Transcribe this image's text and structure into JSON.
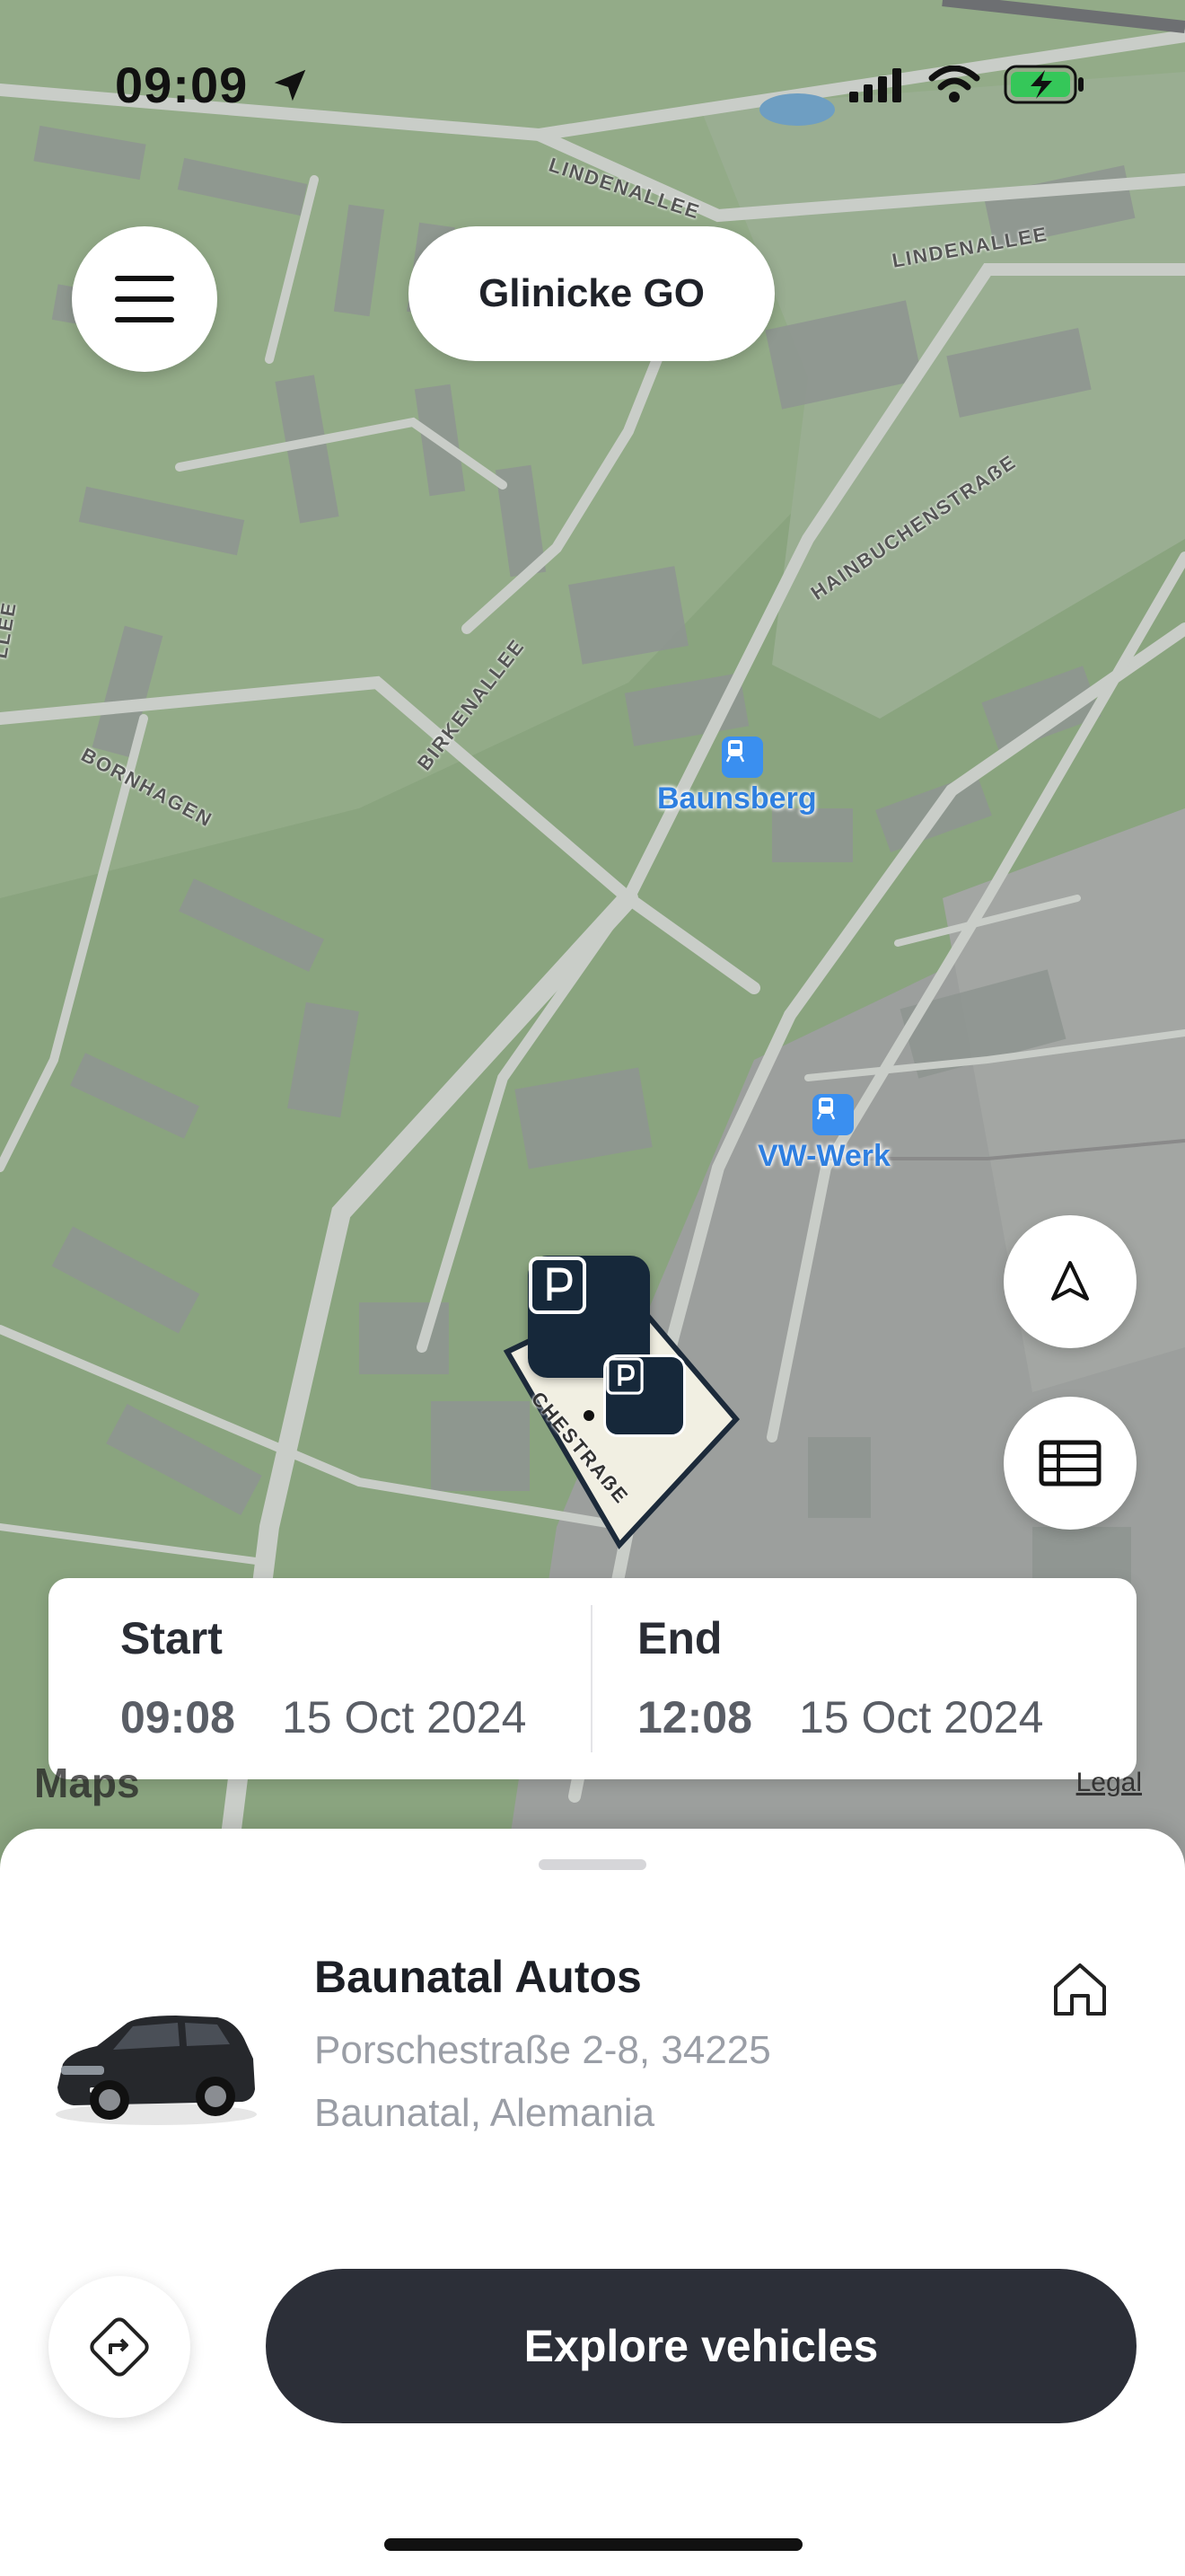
{
  "status_bar": {
    "time": "09:09"
  },
  "header": {
    "title": "Glinicke GO"
  },
  "map": {
    "places": [
      {
        "name": "Baunsberg"
      },
      {
        "name": "VW-Werk"
      }
    ],
    "streets": {
      "lindenallee_a": "LINDENALLEE",
      "lindenallee_b": "LINDENALLEE",
      "hainbuchenstrasse": "HAINBUCHENSTRAẞE",
      "birkenallee": "BIRKENALLEE",
      "bornhagen": "BORNHAGEN",
      "allee_edge": "LLEE",
      "porschestrasse": "CHESTRAẞE"
    },
    "credit": "Maps",
    "legal": "Legal"
  },
  "booking_time": {
    "start": {
      "label": "Start",
      "time": "09:08",
      "date": "15 Oct 2024"
    },
    "end": {
      "label": "End",
      "time": "12:08",
      "date": "15 Oct 2024"
    }
  },
  "location": {
    "name": "Baunatal Autos",
    "address_line1": "Porschestraße 2-8, 34225",
    "address_line2": "Baunatal, Alemania"
  },
  "actions": {
    "explore_label": "Explore vehicles"
  },
  "colors": {
    "accent_dark": "#2c2f38",
    "transit_blue": "#2f7fe0",
    "map_green": "#7d9c6f"
  }
}
